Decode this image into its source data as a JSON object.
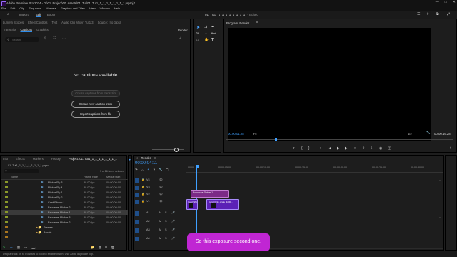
{
  "app": {
    "title": "Adobe Premiere Pro 2024 - D:\\01. Project\\00. Assets\\01. Tut\\01. Tut1_1_1_1_1_1_1_1_1.prproj *"
  },
  "menu": [
    "File",
    "Edit",
    "Clip",
    "Sequence",
    "Markers",
    "Graphics and Titles",
    "View",
    "Window",
    "Help"
  ],
  "workspace": {
    "tabs": [
      "Import",
      "Edit",
      "Export"
    ],
    "active": "Edit",
    "sequence_title": "01. Tut1_1_1_1_1_1_1_1_1",
    "sequence_status": "- Edited"
  },
  "top_left_panel": {
    "tabs_row1": [
      "Lumetri Scopes",
      "Effect Controls",
      "Text",
      "Audio Clip Mixer: Tut1.3",
      "Source: (no clips)"
    ],
    "tabs_row2": [
      "Transcript",
      "Captions",
      "Graphics"
    ],
    "active_tab": "Captions",
    "render_label": "Render",
    "search_placeholder": "Search",
    "empty_title": "No captions available",
    "btn_create_from_transcript": "Create captions from transcript",
    "btn_new_track": "Create new caption track",
    "btn_import": "Import captions from file"
  },
  "program": {
    "title": "Program: Render",
    "timecode_left": "00:00:01:28",
    "fit": "Fit",
    "zoom": "1/2",
    "timecode_right": "00:00:16:28"
  },
  "project_panel": {
    "tabs": [
      "Info",
      "Effects",
      "Markers",
      "History",
      "Project: 01. Tut1_1_1_1_1_1_1_1_1"
    ],
    "active_tab": "Project: 01. Tut1_1_1_1_1_1_1_1_1",
    "path": "01. Tut1_1_1_1_1_1_1_1_1.prproj",
    "selection_info": "1 of 86 items selected",
    "columns": [
      "Name",
      "Frame Rate",
      "Media Start"
    ],
    "rows": [
      {
        "name": "Flicker Fly 3",
        "fps": "30.00 fps",
        "start": "00:00:00:00",
        "selected": false
      },
      {
        "name": "Flicker Fly 4",
        "fps": "30.00 fps",
        "start": "00:00:00:00",
        "selected": false
      },
      {
        "name": "Flicker Fly 1",
        "fps": "30.00 fps",
        "start": "00:00:00:00",
        "selected": false
      },
      {
        "name": "Flicker Fly 2",
        "fps": "30.00 fps",
        "start": "00:00:00:00",
        "selected": false
      },
      {
        "name": "Card Flicker 1",
        "fps": "30.00 fps",
        "start": "00:00:00:00",
        "selected": false
      },
      {
        "name": "Exposure Flicker 2",
        "fps": "30.00 fps",
        "start": "00:00:00:00",
        "selected": false
      },
      {
        "name": "Exposure Flicker 1",
        "fps": "30.00 fps",
        "start": "00:00:00:00",
        "selected": true
      },
      {
        "name": "Exposure Flicker 3",
        "fps": "30.00 fps",
        "start": "00:00:00:00",
        "selected": false
      },
      {
        "name": "Exposure Flicker 2",
        "fps": "30.00 fps",
        "start": "00:00:00:00",
        "selected": false
      }
    ],
    "folders": [
      "Frames",
      "Assets"
    ]
  },
  "timeline": {
    "tab": "Render",
    "timecode": "00:00:04:11",
    "ruler": [
      "00:00",
      "00:00:05:00",
      "00:00:10:00",
      "00:00:15:00",
      "00:00:20:00",
      "00:00:25:00",
      "00:00:30:00"
    ],
    "video_tracks": [
      "V4",
      "V3",
      "V2",
      "V1"
    ],
    "audio_tracks": [
      "A1",
      "A2",
      "A3",
      "A4"
    ],
    "clips": {
      "v2_label": "Exposure Flicker 1",
      "v1_a_label": "Card Wht...",
      "v1_b_label": "Card Flick...scale_3200..."
    },
    "clip_colors": {
      "v2": "#7b2a86",
      "v1": "#5b21b6",
      "v1_head": "#2f3fa8"
    }
  },
  "status_bar": {
    "text": "Drop a track on to Forward to Tool to enable Insert. Use Alt to duplicate clip."
  },
  "subtitle": {
    "text": "So this exposure second one.",
    "color": "#c026d3"
  },
  "colors": {
    "accent": "#2d8ceb",
    "track_target": "#1f4f8a"
  }
}
